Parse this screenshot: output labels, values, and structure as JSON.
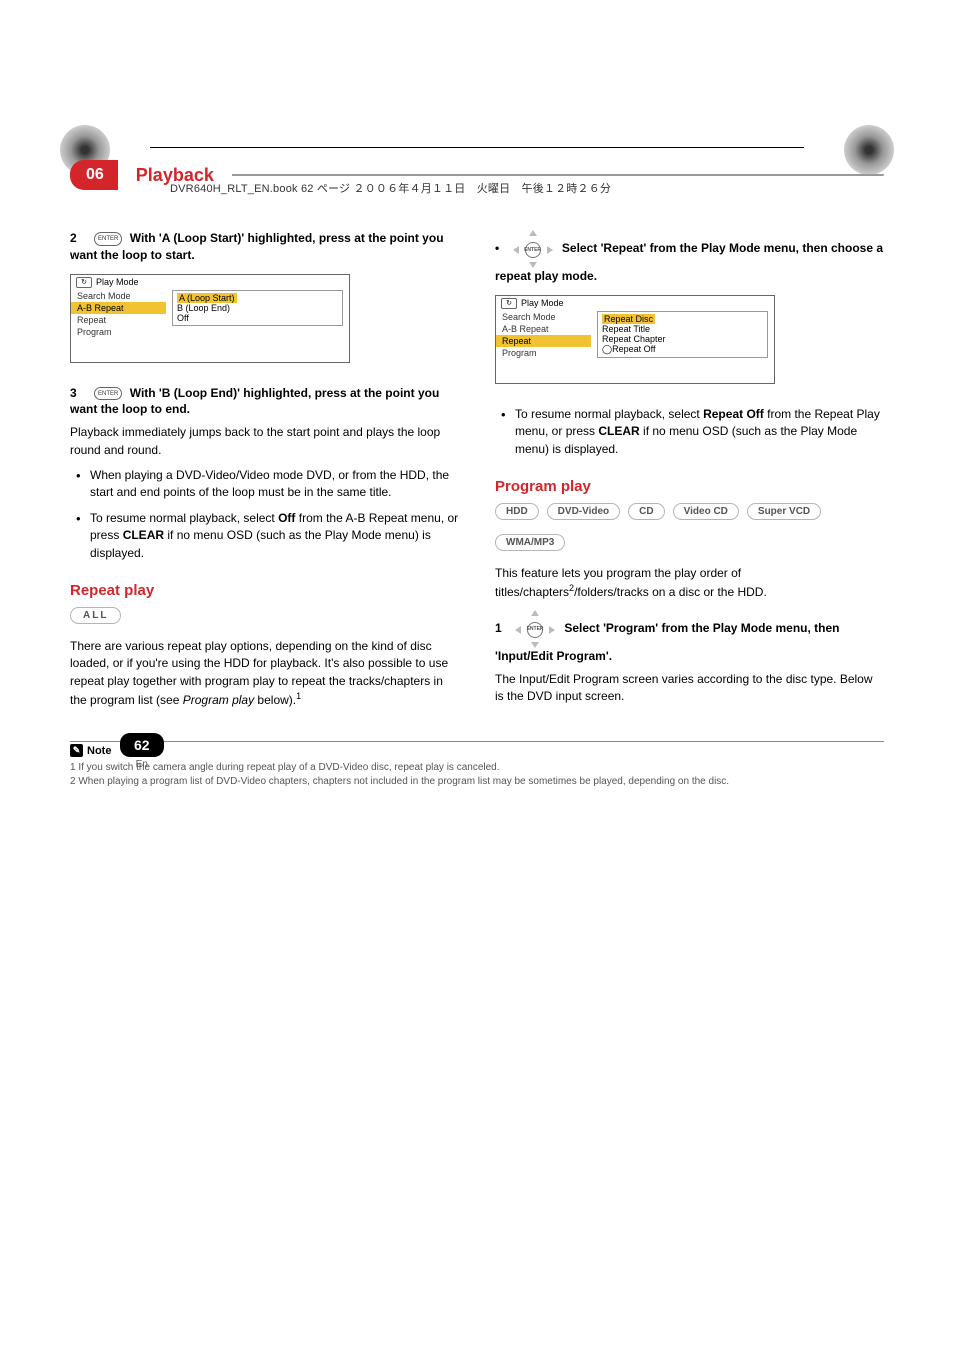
{
  "header_jp": "DVR640H_RLT_EN.book 62 ページ ２００６年４月１１日　火曜日　午後１２時２６分",
  "chapter": {
    "num": "06",
    "title": "Playback"
  },
  "left": {
    "step2": {
      "num": "2",
      "btn": "ENTER",
      "text_a": "With 'A (Loop Start)' highlighted, press at the point you want the loop to start."
    },
    "menu1": {
      "title": "Play Mode",
      "items": [
        "Search Mode",
        "A-B Repeat",
        "Repeat",
        "Program"
      ],
      "right": {
        "a": "A (Loop Start)",
        "b": "B (Loop End)",
        "off": "Off"
      }
    },
    "step3": {
      "num": "3",
      "btn": "ENTER",
      "text_a": "With 'B (Loop End)' highlighted, press at the point you want the loop to end."
    },
    "para1": "Playback immediately jumps back to the start point and plays the loop round and round.",
    "b1": "When playing a DVD-Video/Video mode DVD, or from the HDD, the start and end points of the loop must be in the same title.",
    "b2a": "To resume normal playback, select ",
    "b2_off": "Off",
    "b2b": " from the A-B Repeat menu, or press ",
    "b2_clear": "CLEAR",
    "b2c": " if no menu OSD (such as the Play Mode menu) is displayed.",
    "sec_repeat": "Repeat play",
    "badge_all": "ALL",
    "rp_para_a": "There are various repeat play options, depending on the kind of disc loaded, or if you're using the HDD for playback. It's also possible to use repeat play together with program play to repeat the tracks/chapters in the program list (see ",
    "rp_para_i": "Program play",
    "rp_para_b": " below)."
  },
  "right": {
    "step_dot": {
      "bullet": "•",
      "btn": "ENTER",
      "text": "Select 'Repeat' from the Play Mode menu, then choose a repeat play mode."
    },
    "menu2": {
      "title": "Play Mode",
      "items": [
        "Search Mode",
        "A-B Repeat",
        "Repeat",
        "Program"
      ],
      "right": [
        "Repeat Disc",
        "Repeat Title",
        "Repeat Chapter",
        "Repeat Off"
      ],
      "mark": "◯"
    },
    "bul_a": "To resume normal playback, select ",
    "bul_repoff": "Repeat Off",
    "bul_b": " from the Repeat Play menu, or press ",
    "bul_clear": "CLEAR",
    "bul_c": " if no menu OSD (such as the Play Mode menu) is displayed.",
    "sec_program": "Program play",
    "badges": [
      "HDD",
      "DVD-Video",
      "CD",
      "Video CD",
      "Super VCD"
    ],
    "badges2": [
      "WMA/MP3"
    ],
    "pp_a": "This feature lets you program the play order of titles/chapters",
    "pp_b": "/folders/tracks on a disc or the HDD.",
    "step1": {
      "num": "1",
      "btn": "ENTER",
      "text": "Select 'Program' from the Play Mode menu, then 'Input/Edit Program'."
    },
    "pp2": "The Input/Edit Program screen varies according to the disc type. Below is the DVD input screen."
  },
  "notes": {
    "label": "Note",
    "n1": "1 If you switch the camera angle during repeat play of a DVD-Video disc, repeat play is canceled.",
    "n2": "2 When playing a program list of DVD-Video chapters, chapters not included in the program list may be sometimes be played, depending on the disc."
  },
  "footer": {
    "page": "62",
    "lang": "En"
  }
}
